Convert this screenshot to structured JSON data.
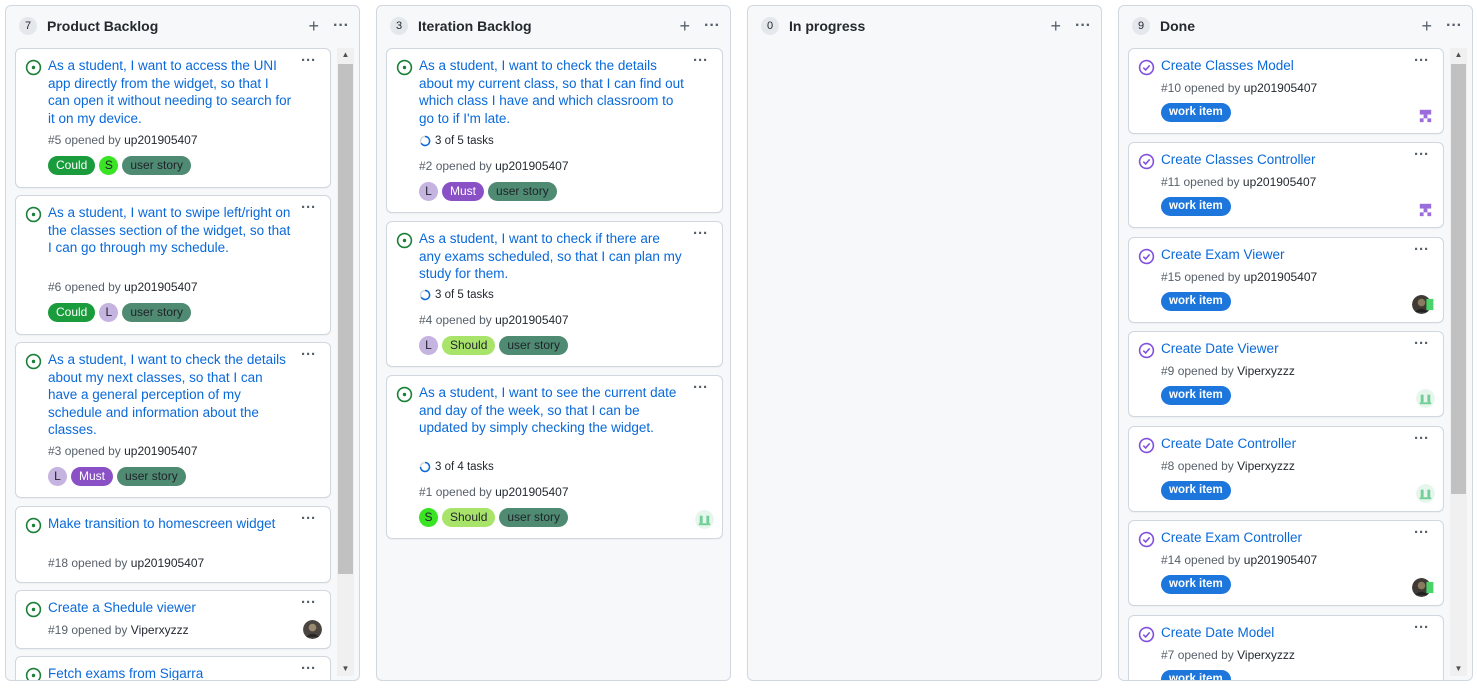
{
  "columns": {
    "backlog": {
      "count": "7",
      "title": "Product Backlog",
      "cards": [
        {
          "title": "As a student, I want to access the UNI app directly from the widget, so that I can open it without needing to search for it on my device.",
          "number": "#5",
          "opened_by": "opened by",
          "author": "up201905407",
          "labels": [
            "Could",
            "S",
            "user story"
          ]
        },
        {
          "title": "As a student, I want to swipe left/right on the classes section of the widget, so that I can go through my schedule.",
          "number": "#6",
          "opened_by": "opened by",
          "author": "up201905407",
          "labels": [
            "Could",
            "L",
            "user story"
          ]
        },
        {
          "title": "As a student, I want to check the details about my next classes, so that I can have a general perception of my schedule and information about the classes.",
          "number": "#3",
          "opened_by": "opened by",
          "author": "up201905407",
          "labels": [
            "L",
            "Must",
            "user story"
          ]
        },
        {
          "title": "Make transition to homescreen widget",
          "number": "#18",
          "opened_by": "opened by",
          "author": "up201905407"
        },
        {
          "title": "Create a Shedule viewer",
          "number": "#19",
          "opened_by": "opened by",
          "author": "Viperxyzzz"
        },
        {
          "title": "Fetch exams from Sigarra"
        }
      ]
    },
    "iteration": {
      "count": "3",
      "title": "Iteration Backlog",
      "cards": [
        {
          "title": "As a student, I want to check the details about my current class, so that I can find out which class I have and which classroom to go to if I'm late.",
          "tasks": "3 of 5 tasks",
          "number": "#2",
          "opened_by": "opened by",
          "author": "up201905407",
          "labels": [
            "L",
            "Must",
            "user story"
          ]
        },
        {
          "title": "As a student, I want to check if there are any exams scheduled, so that I can plan my study for them.",
          "tasks": "3 of 5 tasks",
          "number": "#4",
          "opened_by": "opened by",
          "author": "up201905407",
          "labels": [
            "L",
            "Should",
            "user story"
          ]
        },
        {
          "title": "As a student, I want to see the current date and day of the week, so that I can be updated by simply checking the widget.",
          "tasks": "3 of 4 tasks",
          "number": "#1",
          "opened_by": "opened by",
          "author": "up201905407",
          "labels": [
            "S",
            "Should",
            "user story"
          ]
        }
      ]
    },
    "progress": {
      "count": "0",
      "title": "In progress"
    },
    "done": {
      "count": "9",
      "title": "Done",
      "cards": [
        {
          "title": "Create Classes Model",
          "number": "#10",
          "opened_by": "opened by",
          "author": "up201905407",
          "label": "work item"
        },
        {
          "title": "Create Classes Controller",
          "number": "#11",
          "opened_by": "opened by",
          "author": "up201905407",
          "label": "work item"
        },
        {
          "title": "Create Exam Viewer",
          "number": "#15",
          "opened_by": "opened by",
          "author": "up201905407",
          "label": "work item"
        },
        {
          "title": "Create Date Viewer",
          "number": "#9",
          "opened_by": "opened by",
          "author": "Viperxyzzz",
          "label": "work item"
        },
        {
          "title": "Create Date Controller",
          "number": "#8",
          "opened_by": "opened by",
          "author": "Viperxyzzz",
          "label": "work item"
        },
        {
          "title": "Create Exam Controller",
          "number": "#14",
          "opened_by": "opened by",
          "author": "up201905407",
          "label": "work item"
        },
        {
          "title": "Create Date Model",
          "number": "#7",
          "opened_by": "opened by",
          "author": "Viperxyzzz",
          "label": "work item"
        }
      ]
    }
  },
  "actions": {
    "add": "+",
    "more": "···"
  },
  "colors": {
    "link": "#0969da",
    "open": "#1a7f37",
    "closed": "#8250df",
    "could": "#1a9b3c",
    "must": "#8a51c6",
    "should": "#a9e46a",
    "story": "#4f8a73",
    "work": "#1d76db"
  }
}
